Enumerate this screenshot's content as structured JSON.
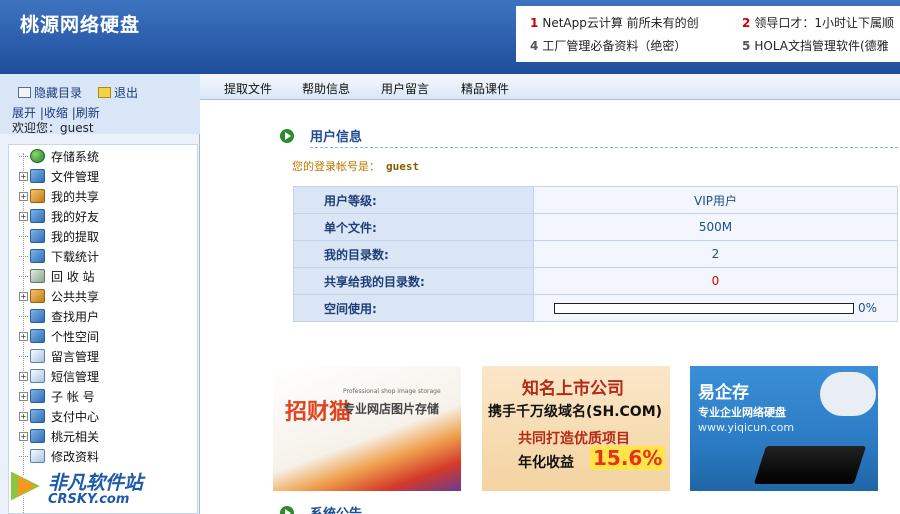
{
  "header": {
    "title": "桃源网络硬盘",
    "ads": [
      {
        "num": "1",
        "text": "NetApp云计算 前所未有的创"
      },
      {
        "num": "2",
        "text": "领导口才：1小时让下属顺"
      },
      {
        "num": "4",
        "text": "工厂管理必备资料（绝密）"
      },
      {
        "num": "5",
        "text": "HOLA文挡管理软件(德雅"
      }
    ]
  },
  "sidebar": {
    "hide_label": "隐藏目录",
    "exit_label": "退出",
    "expand_label": "展开",
    "collapse_label": "|收缩",
    "refresh_label": "|刷新",
    "welcome": "欢迎您：guest",
    "tree": [
      {
        "label": "存储系统",
        "icon": "globe-icon"
      },
      {
        "label": "文件管理",
        "icon": "folder-icon"
      },
      {
        "label": "我的共享",
        "icon": "share-people-icon"
      },
      {
        "label": "我的好友",
        "icon": "friends-icon"
      },
      {
        "label": "我的提取",
        "icon": "extract-icon"
      },
      {
        "label": "下载统计",
        "icon": "download-stats-icon"
      },
      {
        "label": "回 收 站",
        "icon": "recycle-bin-icon"
      },
      {
        "label": "公共共享",
        "icon": "public-share-icon"
      },
      {
        "label": "查找用户",
        "icon": "search-user-icon"
      },
      {
        "label": "个性空间",
        "icon": "personal-space-icon"
      },
      {
        "label": "留言管理",
        "icon": "message-icon"
      },
      {
        "label": "短信管理",
        "icon": "sms-icon"
      },
      {
        "label": "子 帐 号",
        "icon": "sub-account-icon"
      },
      {
        "label": "支付中心",
        "icon": "payment-icon"
      },
      {
        "label": "桃元相关",
        "icon": "coin-icon"
      },
      {
        "label": "修改资料",
        "icon": "edit-profile-icon"
      }
    ]
  },
  "topnav": {
    "items": [
      "提取文件",
      "帮助信息",
      "用户留言",
      "精品课件"
    ]
  },
  "main": {
    "section_title": "用户信息",
    "login_label": "您的登录帐号是：",
    "login_user": "guest",
    "table": [
      {
        "key": "用户等级:",
        "value": "VIP用户"
      },
      {
        "key": "单个文件:",
        "value": "500M"
      },
      {
        "key": "我的目录数:",
        "value": "2"
      },
      {
        "key": "共享给我的目录数:",
        "value": "0"
      },
      {
        "key": "空间使用:",
        "value": "0%",
        "progress_fraction": 0
      }
    ],
    "banners": {
      "b1_title": "招财猫",
      "b1_sub": "Professional shop image storage",
      "b1_desc": "专业网店图片存储",
      "b2_l1": "知名上市公司",
      "b2_l2": "携手千万级域名(SH.COM)",
      "b2_l3": "共同打造优质项目",
      "b2_l4": "年化收益",
      "b2_rate": "15.6%",
      "b3_l1": "易企存",
      "b3_l2": "专业企业网络硬盘",
      "b3_l3": "www.yiqicun.com"
    },
    "notice_title": "系统公告"
  },
  "watermark": {
    "cn": "非凡软件站",
    "en": "CRSKY.com"
  },
  "colors": {
    "header_blue": "#2b5fae",
    "accent_red": "#dd0000",
    "section_blue": "#1e4c91"
  }
}
